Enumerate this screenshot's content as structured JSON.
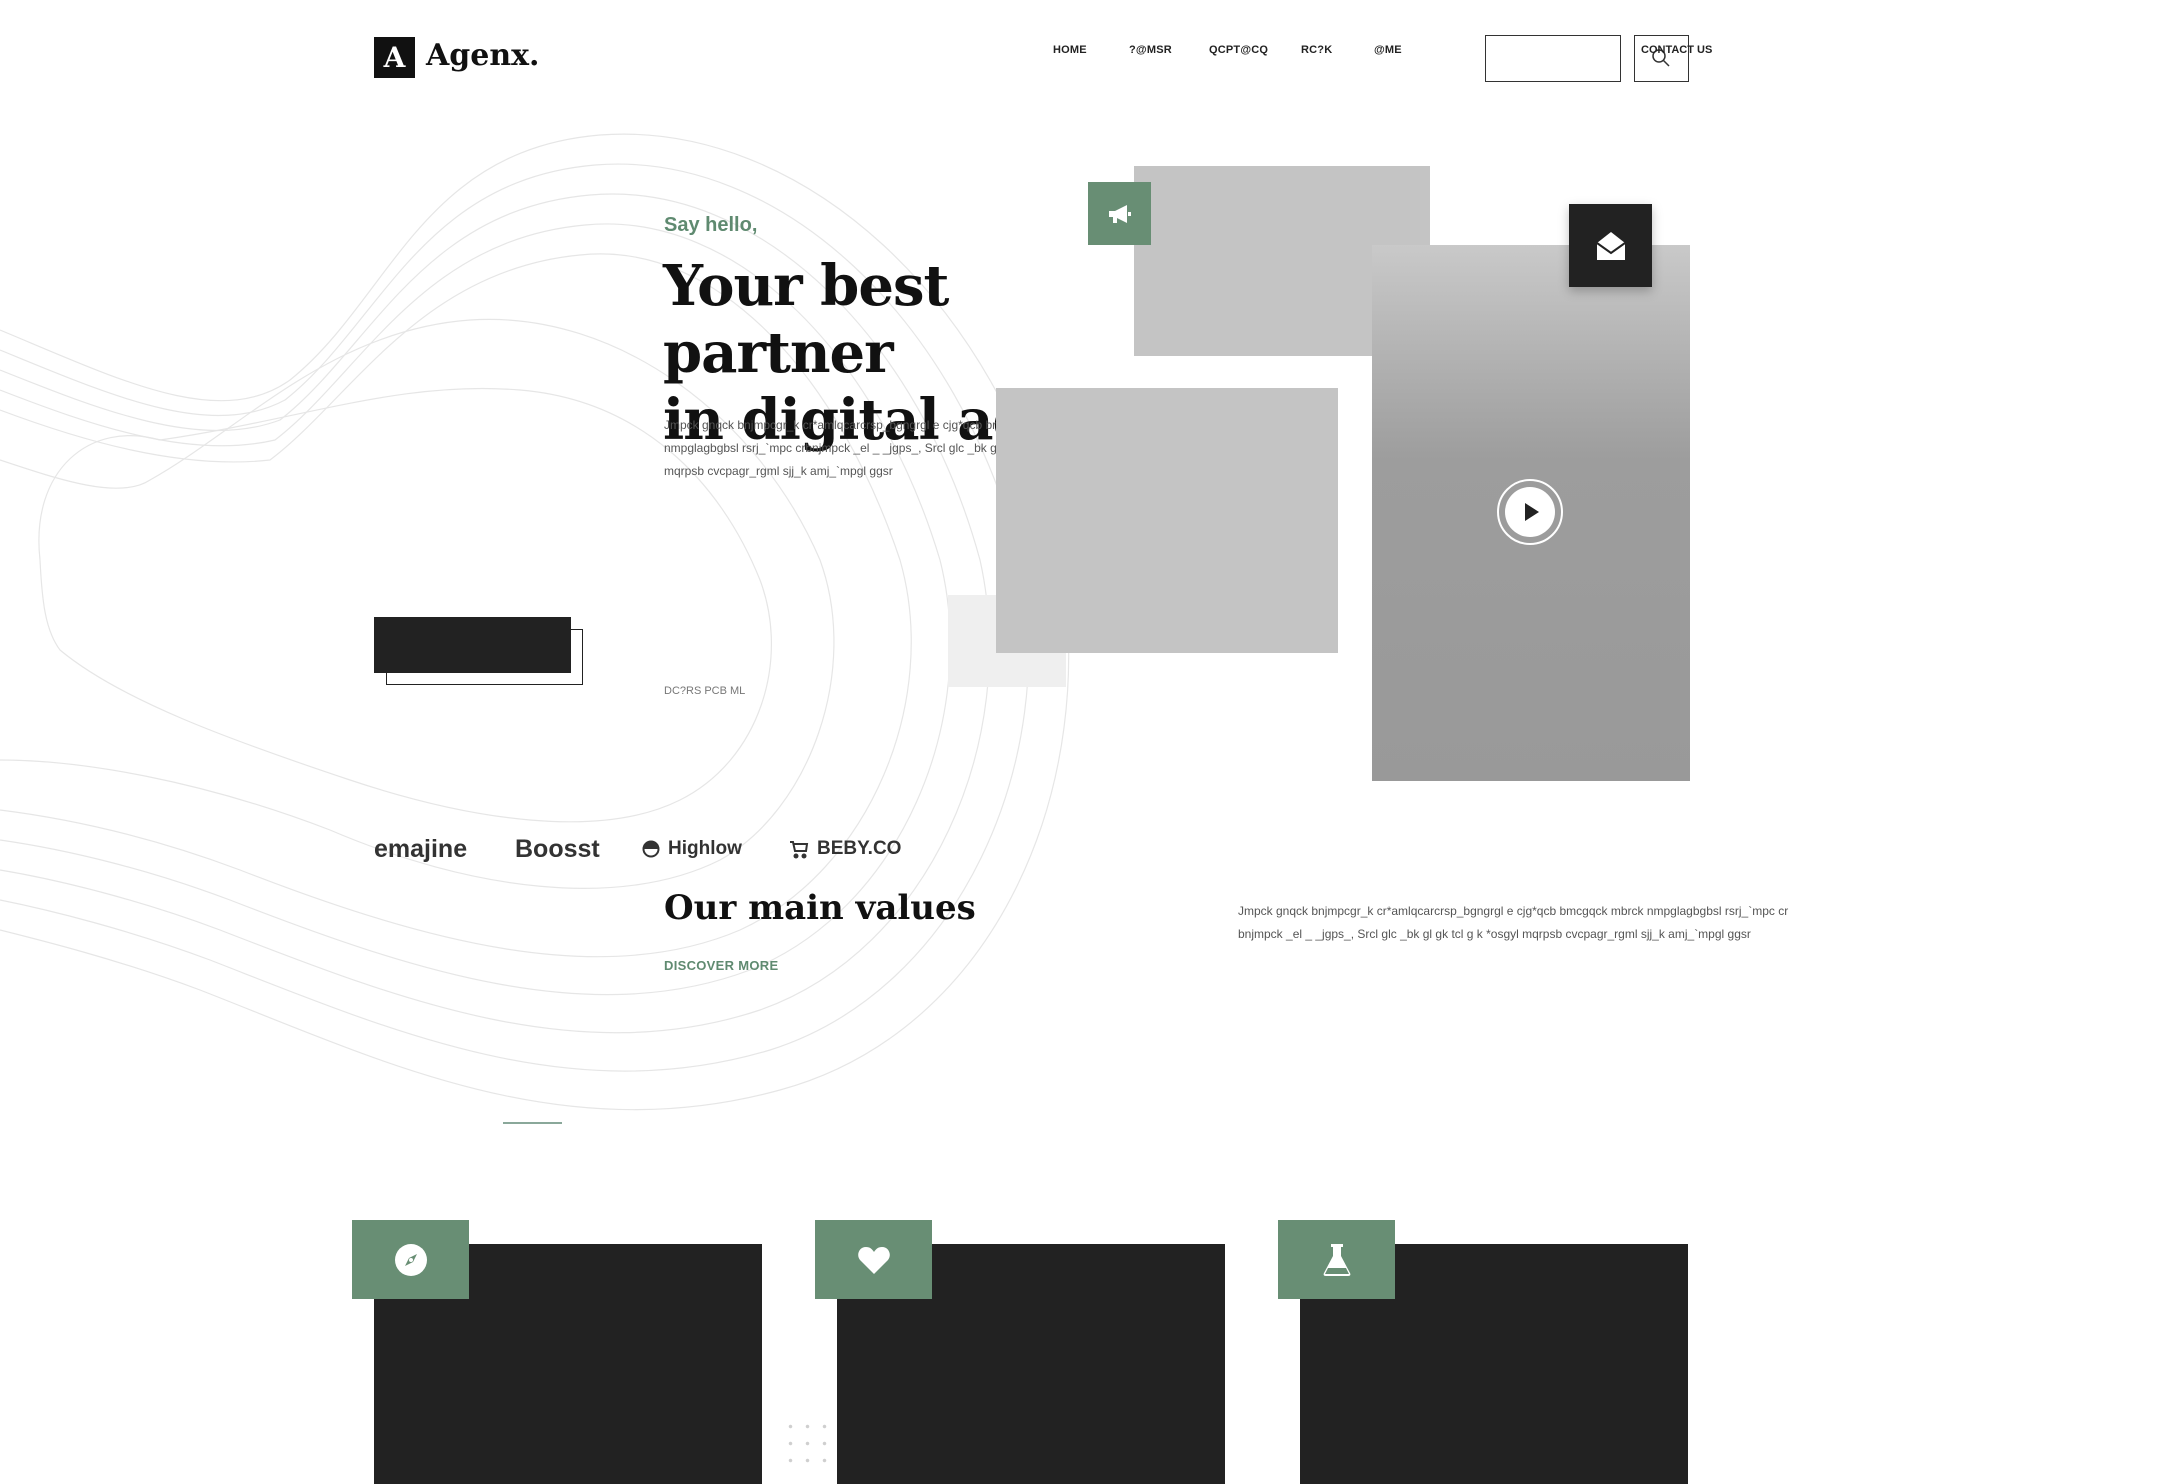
{
  "header": {
    "logo_letter": "A",
    "logo_text": "Agenx.",
    "nav": [
      "HOME",
      "?@MSR",
      "QCPT@CQ",
      "RC?K",
      "@ME"
    ],
    "contact_label": "CONTACT US"
  },
  "hero": {
    "eyebrow": "Say hello,",
    "title_line1": "Your best partner",
    "title_line2": "in digital agency",
    "description": "Jmpck gnqck bnjmpcgr_k cr*amlqcarcrsp_bgngrgl e cjg*qcb bmcgqck mbrck nmpglagbgbsl rsrj_`mpc crbnjmpck _el _ _jgps_, Srcl glc _bk gl gk tcl g k *osgyl mqrpsb cvcpagr_rgml sjj_k amj_`mpgl ggsr",
    "small_link": "DC?RS PCB ML"
  },
  "brands": [
    {
      "name": "emajine",
      "icon": "none"
    },
    {
      "name": "Boosst",
      "icon": "none"
    },
    {
      "name": "Highlow",
      "icon": "half-circle-icon"
    },
    {
      "name": "BEBY.CO",
      "icon": "stroller-icon"
    }
  ],
  "values": {
    "title": "Our main values",
    "discover": "DISCOVER MORE",
    "description": "Jmpck gnqck bnjmpcgr_k cr*amlqcarcrsp_bgngrgl e cjg*qcb bmcgqck mbrck nmpglagbgbsl rsrj_`mpc cr bnjmpck _el _ _jgps_, Srcl glc _bk gl gk tcl g k *osgyl mqrpsb cvcpagr_rgml sjj_k amj_`mpgl ggsr"
  },
  "cards": [
    {
      "icon": "compass-icon"
    },
    {
      "icon": "heart-icon"
    },
    {
      "icon": "flask-icon"
    }
  ],
  "colors": {
    "accent": "#688e74",
    "dark": "#222222",
    "placeholder": "#c4c4c4"
  }
}
